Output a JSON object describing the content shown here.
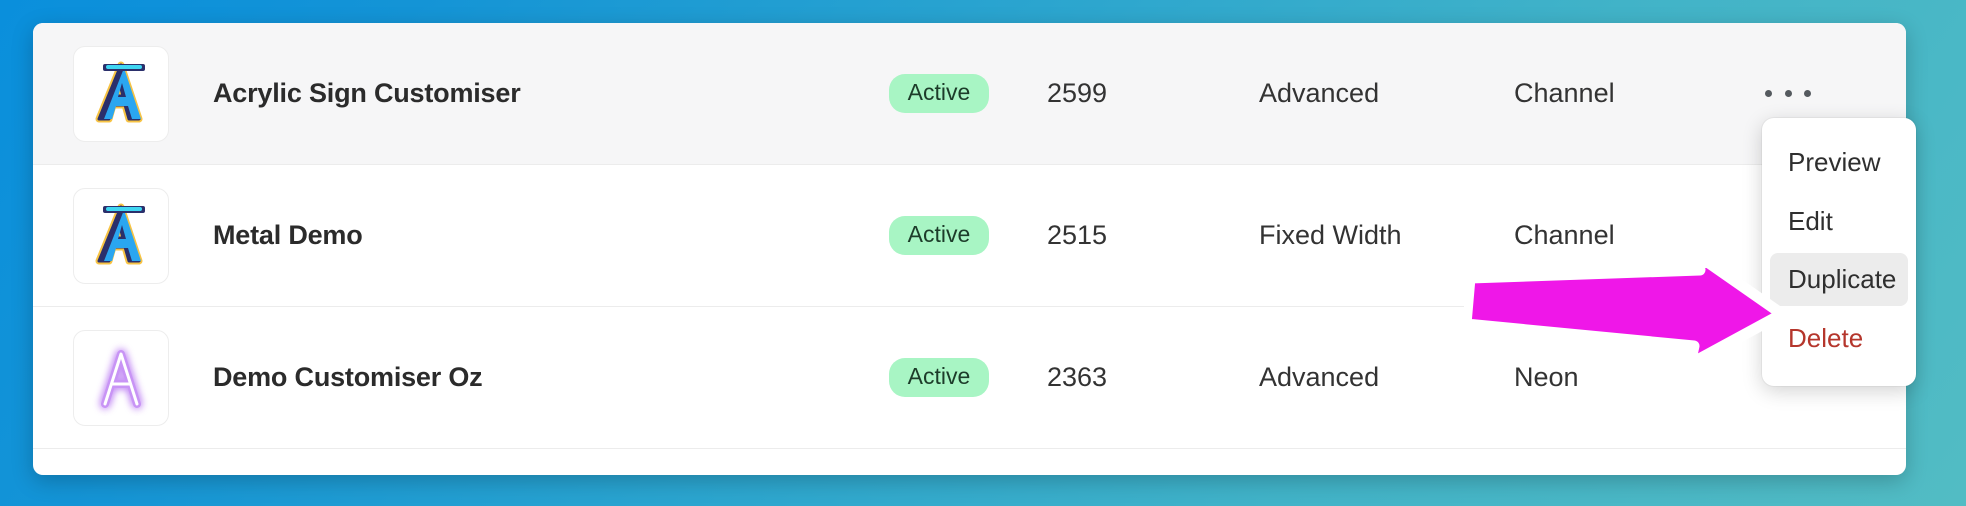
{
  "theme": {
    "background_gradient_from": "#0a8fdc",
    "background_gradient_to": "#52bcc4",
    "card_background": "#ffffff",
    "row_highlight": "#f6f6f7",
    "badge_background": "#a8f5c4",
    "badge_text": "#1d3c2a",
    "danger_color": "#b5362c",
    "annotation_arrow_color": "#ef17e8",
    "annotation_arrow_outline": "#ffffff"
  },
  "table": {
    "rows": [
      {
        "thumbnail_icon": "stylized-letter-a-blue-icon",
        "name": "Acrylic Sign Customiser",
        "status": "Active",
        "id": "2599",
        "type": "Advanced",
        "style": "Channel",
        "actions_icon": "ellipsis-icon",
        "highlighted": true
      },
      {
        "thumbnail_icon": "stylized-letter-a-blue-icon",
        "name": "Metal Demo",
        "status": "Active",
        "id": "2515",
        "type": "Fixed Width",
        "style": "Channel",
        "actions_icon": "ellipsis-icon",
        "highlighted": false
      },
      {
        "thumbnail_icon": "neon-letter-a-purple-icon",
        "name": "Demo Customiser Oz",
        "status": "Active",
        "id": "2363",
        "type": "Advanced",
        "style": "Neon",
        "actions_icon": "ellipsis-icon",
        "highlighted": false
      }
    ]
  },
  "action_menu": {
    "items": [
      {
        "label": "Preview",
        "state": "normal"
      },
      {
        "label": "Edit",
        "state": "normal"
      },
      {
        "label": "Duplicate",
        "state": "highlighted"
      },
      {
        "label": "Delete",
        "state": "danger"
      }
    ]
  },
  "annotation": {
    "type": "arrow",
    "direction": "right",
    "points_to": "Duplicate"
  }
}
